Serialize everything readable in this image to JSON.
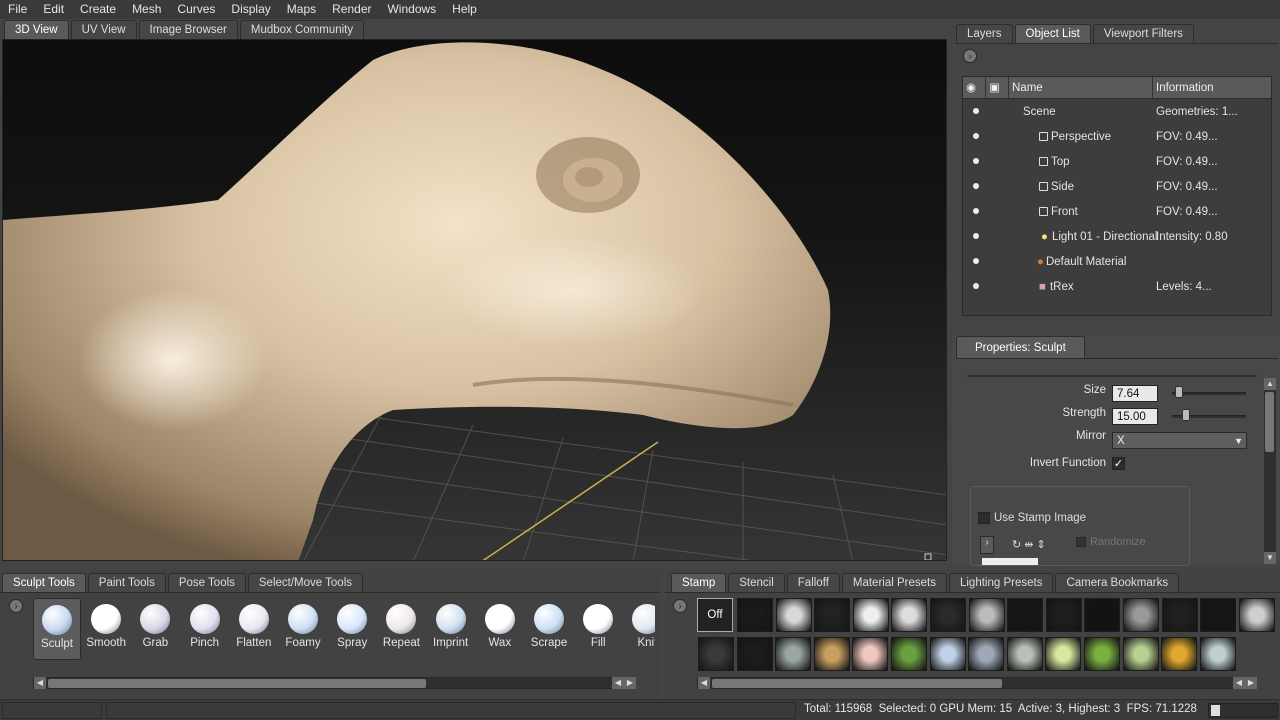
{
  "menu": [
    "File",
    "Edit",
    "Create",
    "Mesh",
    "Curves",
    "Display",
    "Maps",
    "Render",
    "Windows",
    "Help"
  ],
  "view_tabs": [
    {
      "label": "3D View",
      "active": true
    },
    {
      "label": "UV View",
      "active": false
    },
    {
      "label": "Image Browser",
      "active": false
    },
    {
      "label": "Mudbox Community",
      "active": false
    }
  ],
  "right_tabs": [
    {
      "label": "Layers",
      "active": false
    },
    {
      "label": "Object List",
      "active": true
    },
    {
      "label": "Viewport Filters",
      "active": false
    }
  ],
  "object_list": {
    "columns": {
      "name": "Name",
      "info": "Information"
    },
    "rows": [
      {
        "name": "Scene",
        "info": "Geometries: 1...",
        "icon": "scene-icon"
      },
      {
        "name": "Perspective",
        "info": "FOV: 0.49...",
        "icon": "camera-icon"
      },
      {
        "name": "Top",
        "info": "FOV: 0.49...",
        "icon": "camera-icon"
      },
      {
        "name": "Side",
        "info": "FOV: 0.49...",
        "icon": "camera-icon"
      },
      {
        "name": "Front",
        "info": "FOV: 0.49...",
        "icon": "camera-icon"
      },
      {
        "name": "Light 01 - Directional",
        "info": "Intensity: 0.80",
        "icon": "light-icon"
      },
      {
        "name": "Default Material",
        "info": "",
        "icon": "material-icon"
      },
      {
        "name": "tRex",
        "info": "Levels: 4...",
        "icon": "mesh-icon"
      }
    ]
  },
  "properties": {
    "title": "Properties: Sculpt",
    "size_label": "Size",
    "size_value": "7.64",
    "size_fraction": 0.05,
    "strength_label": "Strength",
    "strength_value": "15.00",
    "strength_fraction": 0.15,
    "mirror_label": "Mirror",
    "mirror_value": "X",
    "invert_label": "Invert Function",
    "invert_checked": true,
    "use_stamp_label": "Use Stamp Image",
    "use_stamp_checked": false,
    "randomize_label": "Randomize"
  },
  "tool_tabs": [
    {
      "label": "Sculpt Tools",
      "active": true
    },
    {
      "label": "Paint Tools",
      "active": false
    },
    {
      "label": "Pose Tools",
      "active": false
    },
    {
      "label": "Select/Move Tools",
      "active": false
    }
  ],
  "tools": [
    "Sculpt",
    "Smooth",
    "Grab",
    "Pinch",
    "Flatten",
    "Foamy",
    "Spray",
    "Repeat",
    "Imprint",
    "Wax",
    "Scrape",
    "Fill",
    "Knif"
  ],
  "selected_tool": "Sculpt",
  "tray_tabs": [
    {
      "label": "Stamp",
      "active": true
    },
    {
      "label": "Stencil",
      "active": false
    },
    {
      "label": "Falloff",
      "active": false
    },
    {
      "label": "Material Presets",
      "active": false
    },
    {
      "label": "Lighting Presets",
      "active": false
    },
    {
      "label": "Camera Bookmarks",
      "active": false
    }
  ],
  "stamp_off_label": "Off",
  "status": "Total: 115968  Selected: 0 GPU Mem: 15  Active: 3, Highest: 3  FPS: 71.1228",
  "colors": {
    "model": "#d8c2a3",
    "grid_axis": "#c8b050",
    "accent": "#5a5a5a"
  }
}
